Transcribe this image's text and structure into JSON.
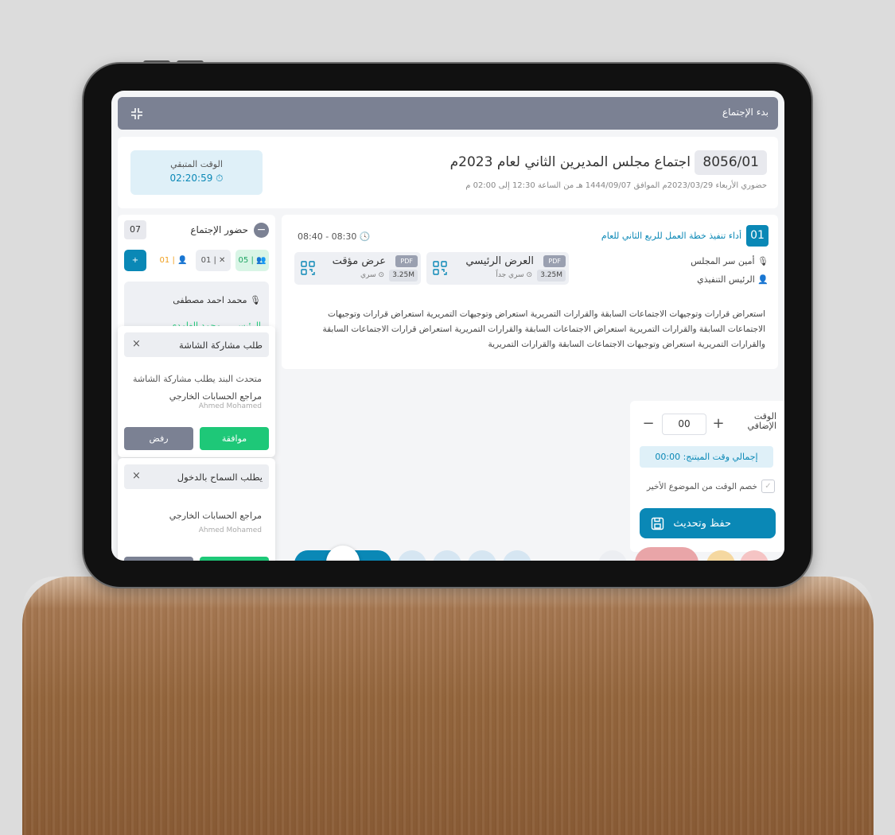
{
  "window": {
    "title": "بدء الإجتماع"
  },
  "meeting": {
    "code": "8056/01",
    "title": "اجتماع مجلس المديرين الثاني لعام 2023م",
    "subtitle": "حضوري  الأربعاء 2023/03/29م الموافق 1444/09/07 هـ  من الساعة 12:30 إلى 02:00 م"
  },
  "remaining": {
    "label": "الوقت المتبقي",
    "value": "02:20:59"
  },
  "attendance": {
    "title": "حضور الإجتماع",
    "count": "07",
    "chips": {
      "present": "05",
      "absent": "01",
      "late": "01"
    },
    "members": [
      "محمد احمد مصطفى",
      "الرئيس ... محمد الغامدي"
    ]
  },
  "agenda": {
    "number": "01",
    "title": "أداء تنفيذ خطة العمل للربع الثاني للعام",
    "time": "08:40 - 08:30",
    "roles": [
      "أمين سر المجلس",
      "الرئيس التنفيذي"
    ],
    "files": [
      {
        "name": "العرض الرئيسي",
        "type": "PDF",
        "size": "3.25M",
        "confidentiality": "سري جداً"
      },
      {
        "name": "عرض مؤقت",
        "type": "PDF",
        "size": "3.25M",
        "confidentiality": "سري"
      }
    ],
    "description": "استعراض قرارات وتوجيهات الاجتماعات السابقة والقرارات التمريرية استعراض وتوجيهات التمريرية استعراض قرارات وتوجيهات الاجتماعات السابقة والقرارات التمريرية استعراض الاجتماعات السابقة والقرارات التمريرية استعراض قرارات الاجتماعات السابقة والقرارات التمريرية استعراض وتوجيهات الاجتماعات السابقة والقرارات التمريرية"
  },
  "extra_time": {
    "label_line1": "الوقت",
    "label_line2": "الإضافي",
    "value": "00",
    "plus": "+",
    "minus": "−",
    "total_label": "إجمالي وقت الميتنج: 00:00",
    "deduct_label": "خصم الوقت من الموضوع الأخير",
    "save_label": "حفظ وتحديث"
  },
  "popups": [
    {
      "title": "طلب مشاركة الشاشة",
      "message": "متحدث البند يطلب مشاركة الشاشة",
      "name_ar": "مراجع الحسابات الخارجي",
      "name_en": "Ahmed Mohamed",
      "accept": "موافقة",
      "reject": "رفض"
    },
    {
      "title": "يطلب السماح بالدخول",
      "name_ar": "مراجع الحسابات الخارجي",
      "name_en": "Ahmed Mohamed"
    }
  ],
  "icons": {
    "collapse": "collapse-icon",
    "calendar": "calendar-icon",
    "clock": "clock-icon",
    "location": "location-pin-icon",
    "mic": "microphone-icon",
    "user": "user-icon",
    "qr": "qr-code-icon",
    "save": "save-icon",
    "close": "close-icon"
  },
  "colors": {
    "accent": "#0a88b6",
    "success": "#1ec878",
    "titlebar": "#7b8193"
  }
}
